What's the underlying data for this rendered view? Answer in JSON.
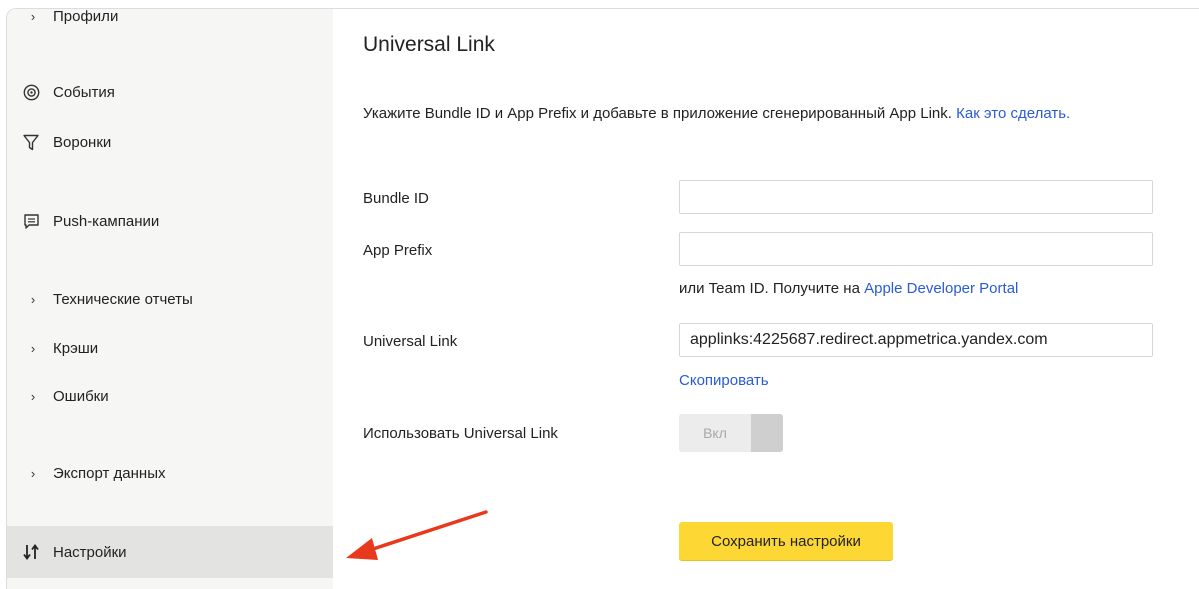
{
  "sidebar": {
    "items": [
      {
        "label": "Профили",
        "icon": "chevron-right-icon"
      },
      {
        "label": "События",
        "icon": "target-icon"
      },
      {
        "label": "Воронки",
        "icon": "funnel-icon"
      },
      {
        "label": "Push-кампании",
        "icon": "message-icon"
      },
      {
        "label": "Технические отчеты",
        "icon": "chevron-right-icon"
      },
      {
        "label": "Крэши",
        "icon": "chevron-right-icon"
      },
      {
        "label": "Ошибки",
        "icon": "chevron-right-icon"
      },
      {
        "label": "Экспорт данных",
        "icon": "chevron-right-icon"
      },
      {
        "label": "Настройки",
        "icon": "sort-arrows-icon",
        "active": true
      }
    ]
  },
  "main": {
    "title": "Universal Link",
    "description": "Укажите Bundle ID и App Prefix и добавьте в приложение сгенерированный App Link.",
    "howto_link": "Как это сделать.",
    "bundle_label": "Bundle ID",
    "bundle_value": "",
    "prefix_label": "App Prefix",
    "prefix_value": "",
    "prefix_hint": "или Team ID. Получите на",
    "prefix_hint_link": "Apple Developer Portal",
    "universal_label": "Universal Link",
    "universal_value": "applinks:4225687.redirect.appmetrica.yandex.com",
    "copy_link": "Скопировать",
    "use_label": "Использовать Universal Link",
    "toggle_label": "Вкл",
    "save_label": "Сохранить настройки"
  },
  "colors": {
    "link": "#2a5bd7",
    "save_button": "#fdd835",
    "annotation_arrow": "#e8391d"
  }
}
